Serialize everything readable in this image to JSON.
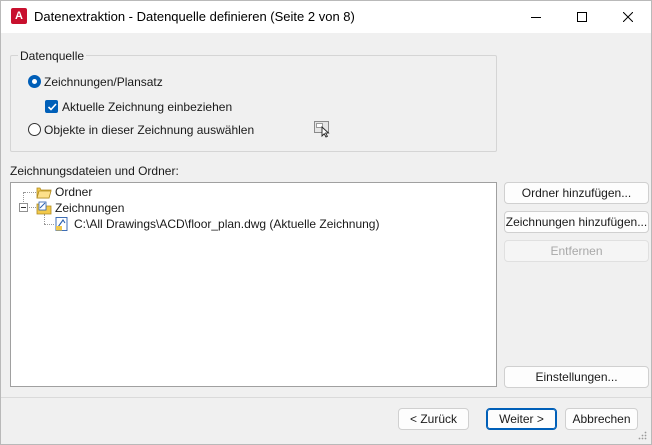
{
  "window": {
    "title": "Datenextraktion - Datenquelle definieren (Seite 2 von 8)",
    "app_icon_letter": "A"
  },
  "datasource": {
    "group_label": "Datenquelle",
    "option_drawings": "Zeichnungen/Plansatz",
    "option_drawings_selected": true,
    "include_current_label": "Aktuelle Zeichnung einbeziehen",
    "include_current_checked": true,
    "option_objects": "Objekte in dieser Zeichnung auswählen",
    "option_objects_selected": false
  },
  "files": {
    "section_label": "Zeichnungsdateien und Ordner:",
    "tree": [
      {
        "label": "Ordner",
        "level": 0
      },
      {
        "label": "Zeichnungen",
        "level": 0,
        "expanded": true
      },
      {
        "label": "C:\\All Drawings\\ACD\\floor_plan.dwg (Aktuelle Zeichnung)",
        "level": 1
      }
    ]
  },
  "side_buttons": {
    "add_folder": "Ordner hinzufügen...",
    "add_drawings": "Zeichnungen hinzufügen...",
    "remove": "Entfernen",
    "settings": "Einstellungen..."
  },
  "footer": {
    "back": "< Zurück",
    "next": "Weiter >",
    "cancel": "Abbrechen"
  },
  "colors": {
    "accent": "#005fb8",
    "app_icon": "#c8102e"
  }
}
